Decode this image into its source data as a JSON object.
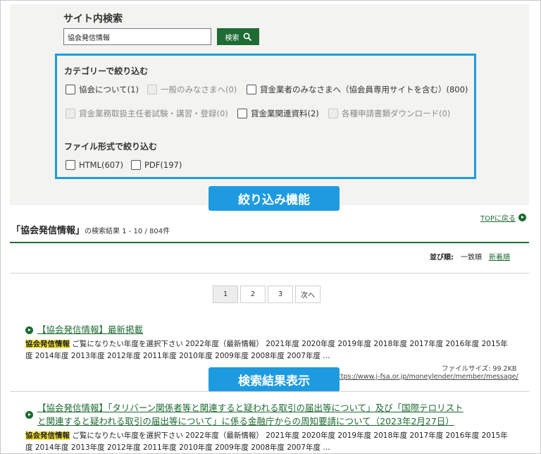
{
  "search": {
    "title": "サイト内検索",
    "query": "協会発信情報",
    "button_label": "検索"
  },
  "filters": {
    "category_heading": "カテゴリーで絞り込む",
    "categories": [
      {
        "label": "協会について(1)",
        "enabled": true
      },
      {
        "label": "一般のみなさまへ(0)",
        "enabled": false
      },
      {
        "label": "貸金業者のみなさまへ（協会員専用サイトを含む）(800)",
        "enabled": true
      },
      {
        "label": "貸金業務取扱主任者試験・講習・登録(0)",
        "enabled": false
      },
      {
        "label": "貸金業関連資料(2)",
        "enabled": true
      },
      {
        "label": "各種申請書類ダウンロード(0)",
        "enabled": false
      }
    ],
    "filetype_heading": "ファイル形式で絞り込む",
    "filetypes": [
      {
        "label": "HTML(607)",
        "enabled": true
      },
      {
        "label": "PDF(197)",
        "enabled": true
      }
    ]
  },
  "callouts": {
    "filter": "絞り込み機能",
    "results": "検索結果表示"
  },
  "top_link": "TOPに戻る",
  "results_header": {
    "open_quote": "「",
    "query": "協会発信情報",
    "close_quote": "」",
    "summary": "の検索結果 1 - 10 / 804件"
  },
  "sort": {
    "label": "並び順:",
    "current": "一致順",
    "alternative": "新着順"
  },
  "pagination": {
    "pages": [
      "1",
      "2",
      "3"
    ],
    "current": "1",
    "next": "次へ"
  },
  "results": [
    {
      "title": "【協会発信情報】最新掲載",
      "highlight": "協会発信情報",
      "snippet_line1": " ご覧になりたい年度を選択下さい 2022年度（最新情報） 2021年度 2020年度 2019年度 2018年度 2017年度 2016年度 2015年",
      "snippet_line2": "度 2014年度 2013年度 2012年度 2011年度 2010年度 2009年度 2008年度 2007年度 …",
      "file_size": "ファイルサイズ: 99.2KB",
      "url": "https://www.j-fsa.or.jp/moneylender/member/message/"
    },
    {
      "title_line1": "【協会発信情報】「タリバーン関係者等と関連すると疑われる取引の届出等について」及び「国際テロリスト",
      "title_line2": "と関連すると疑われる取引の届出等について」に係る金融庁からの周知要請について（2023年2月27日）",
      "highlight": "協会発信情報",
      "snippet_line1": " ご覧になりたい年度を選択下さい 2022年度（最新情報） 2021年度 2020年度 2019年度 2018年度 2017年度 2016年度 2015年",
      "snippet_line2": "度 2014年度 2013年度 2012年度 2011年度 2010年度 2009年度 2008年度 2007年度 …"
    }
  ],
  "colors": {
    "brand_green": "#1d6a32",
    "callout_blue": "#1e9be0",
    "highlight_yellow": "#ffeb3b",
    "panel_bg": "#f3f4f1"
  }
}
